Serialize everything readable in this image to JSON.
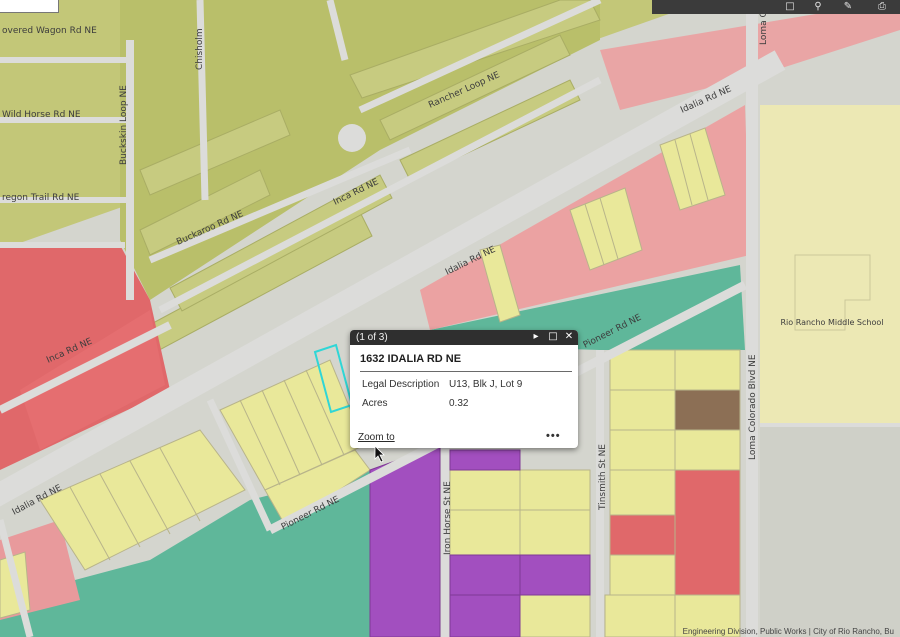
{
  "map": {
    "street_labels": {
      "covered_wagon": "overed Wagon Rd NE",
      "wild_horse": "Wild Horse Rd NE",
      "oregon_trail": "regon Trail Rd NE",
      "buckskin_loop": "Buckskin Loop NE",
      "chisholm": "Chisholm",
      "rancher_loop": "Rancher Loop NE",
      "buckaroo": "Buckaroo Rd NE",
      "inca_upper": "Inca Rd NE",
      "inca_left": "Inca Rd NE",
      "idalia_top": "Idalia Rd NE",
      "idalia_mid": "Idalia Rd NE",
      "idalia_lower": "Idalia Rd NE",
      "pioneer_right": "Pioneer Rd NE",
      "pioneer_lower": "Pioneer Rd NE",
      "iron_horse": "Iron Horse St NE",
      "tinsmith": "Tinsmith St NE",
      "loma_colorado_blvd": "Loma Colorado Blvd NE",
      "loma_colorado_top": "Loma Colorad",
      "school": "Rio Rancho Middle School"
    },
    "zone_colors": {
      "residential_green": "#c3c778",
      "commercial_pink": "#eba2a2",
      "commercial_red": "#e0686a",
      "yellow_lot": "#e9e89a",
      "institutional_teal": "#5fb79a",
      "purple_lot": "#a24fbf",
      "brown_lot": "#8c6f55",
      "road": "#d8d8d6",
      "school_beige": "#ece8b4"
    }
  },
  "toolbar": {
    "icons": [
      "bookmark-icon",
      "search-icon",
      "measure-icon",
      "print-icon"
    ]
  },
  "popup": {
    "counter": "(1 of 3)",
    "title": "1632 IDALIA RD NE",
    "fields": [
      {
        "label": "Legal Description",
        "value": "U13, Blk J, Lot 9"
      },
      {
        "label": "Acres",
        "value": "0.32"
      }
    ],
    "zoom_label": "Zoom to",
    "more_label": "•••"
  },
  "attribution": "Engineering Division, Public Works | City of Rio Rancho, Bu"
}
